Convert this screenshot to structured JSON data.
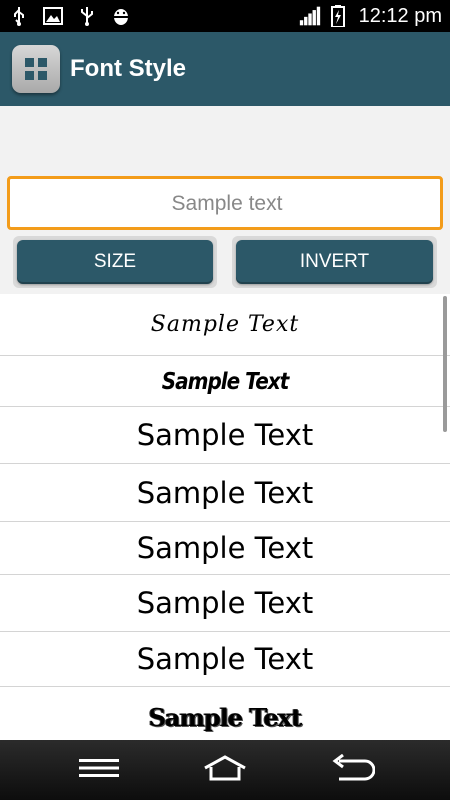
{
  "status_bar": {
    "time": "12:12 pm",
    "icons": [
      "usb-icon",
      "image-icon",
      "usb-icon",
      "android-debug-icon",
      "signal-icon",
      "battery-charging-icon"
    ]
  },
  "action_bar": {
    "title": "Font Style",
    "app_icon": "grid-app-icon"
  },
  "input": {
    "placeholder": "Sample text",
    "value": ""
  },
  "buttons": {
    "size_label": "SIZE",
    "invert_label": "INVERT"
  },
  "font_list": [
    {
      "text": "Sample Text",
      "style": "script"
    },
    {
      "text": "Sample Text",
      "style": "brush"
    },
    {
      "text": "Sample Text",
      "style": "plain"
    },
    {
      "text": "Sample Text",
      "style": "plain"
    },
    {
      "text": "Sample Text",
      "style": "plain"
    },
    {
      "text": "Sample Text",
      "style": "plain"
    },
    {
      "text": "Sample Text",
      "style": "plain"
    },
    {
      "text": "Sample Text",
      "style": "grunge"
    }
  ],
  "nav_bar": {
    "icons": [
      "menu-icon",
      "home-icon",
      "back-icon"
    ]
  },
  "colors": {
    "accent": "#2c5868",
    "input_border": "#f39c1a"
  }
}
